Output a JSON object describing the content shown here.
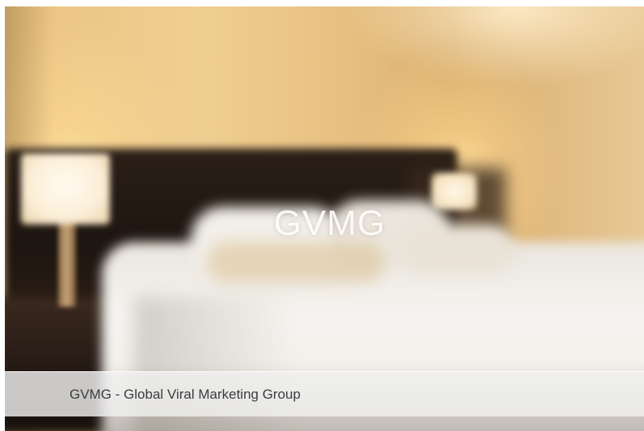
{
  "slide": {
    "image_label": "GVMG",
    "caption": "GVMG - Global Viral Marketing Group"
  },
  "colors": {
    "caption_bar": "#f0f0f0",
    "caption_text": "#3c3c3c",
    "logo_text": "#ffffff"
  }
}
